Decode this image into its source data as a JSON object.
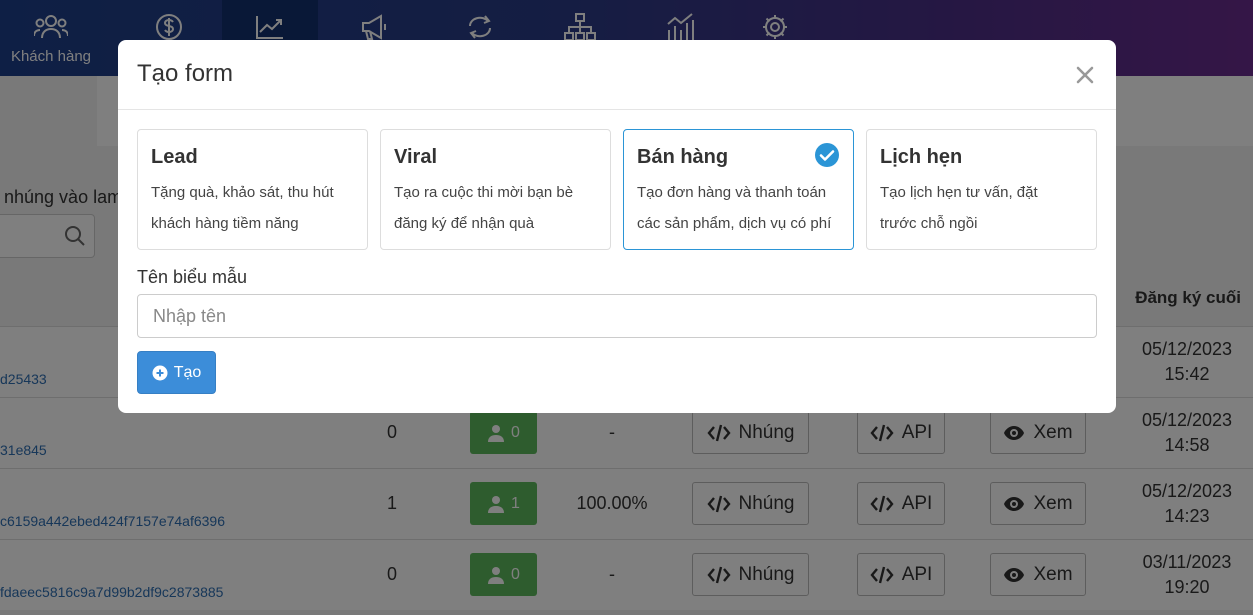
{
  "nav": {
    "items": [
      {
        "label": "Khách hàng",
        "icon": "users-icon"
      },
      {
        "label": "",
        "icon": "dollar-icon"
      },
      {
        "label": "",
        "icon": "chart-line-icon"
      },
      {
        "label": "",
        "icon": "megaphone-icon"
      },
      {
        "label": "",
        "icon": "refresh-icon"
      },
      {
        "label": "",
        "icon": "sitemap-icon"
      },
      {
        "label": "",
        "icon": "bar-chart-icon"
      },
      {
        "label": "",
        "icon": "gear-icon"
      }
    ]
  },
  "background": {
    "partial_text": "nhúng vào lam",
    "column_header": "Đăng ký cuối",
    "rows": [
      {
        "id": "d25433",
        "count": "",
        "users": "",
        "pct": "",
        "embed": "",
        "api": "",
        "view": "",
        "date": "05/12/2023",
        "time": "15:42"
      },
      {
        "id": "31e845",
        "count": "0",
        "users": "0",
        "pct": "-",
        "embed": "Nhúng",
        "api": "API",
        "view": "Xem",
        "date": "05/12/2023",
        "time": "14:58"
      },
      {
        "id": "c6159a442ebed424f7157e74af6396",
        "count": "1",
        "users": "1",
        "pct": "100.00%",
        "embed": "Nhúng",
        "api": "API",
        "view": "Xem",
        "date": "05/12/2023",
        "time": "14:23"
      },
      {
        "id": "fdaeec5816c9a7d99b2df9c2873885",
        "count": "0",
        "users": "0",
        "pct": "-",
        "embed": "Nhúng",
        "api": "API",
        "view": "Xem",
        "date": "03/11/2023",
        "time": "19:20"
      }
    ]
  },
  "modal": {
    "title": "Tạo form",
    "cards": [
      {
        "title": "Lead",
        "desc1": "Tặng quà, khảo sát, thu hút",
        "desc2": "khách hàng tiềm năng",
        "selected": false
      },
      {
        "title": "Viral",
        "desc1": "Tạo ra cuộc thi mời bạn bè",
        "desc2": "đăng ký để nhận quà",
        "selected": false
      },
      {
        "title": "Bán hàng",
        "desc1": "Tạo đơn hàng và thanh toán",
        "desc2": "các sản phẩm, dịch vụ có phí",
        "selected": true
      },
      {
        "title": "Lịch hẹn",
        "desc1": "Tạo lịch hẹn tư vấn, đặt",
        "desc2": "trước chỗ ngồi",
        "selected": false
      }
    ],
    "name_label": "Tên biểu mẫu",
    "name_placeholder": "Nhập tên",
    "name_value": "",
    "create_label": "Tạo"
  },
  "colors": {
    "accent": "#3c8dd9",
    "selected_border": "#2b95d6",
    "badge_green": "#5cb85c",
    "link": "#2f6fb3"
  }
}
